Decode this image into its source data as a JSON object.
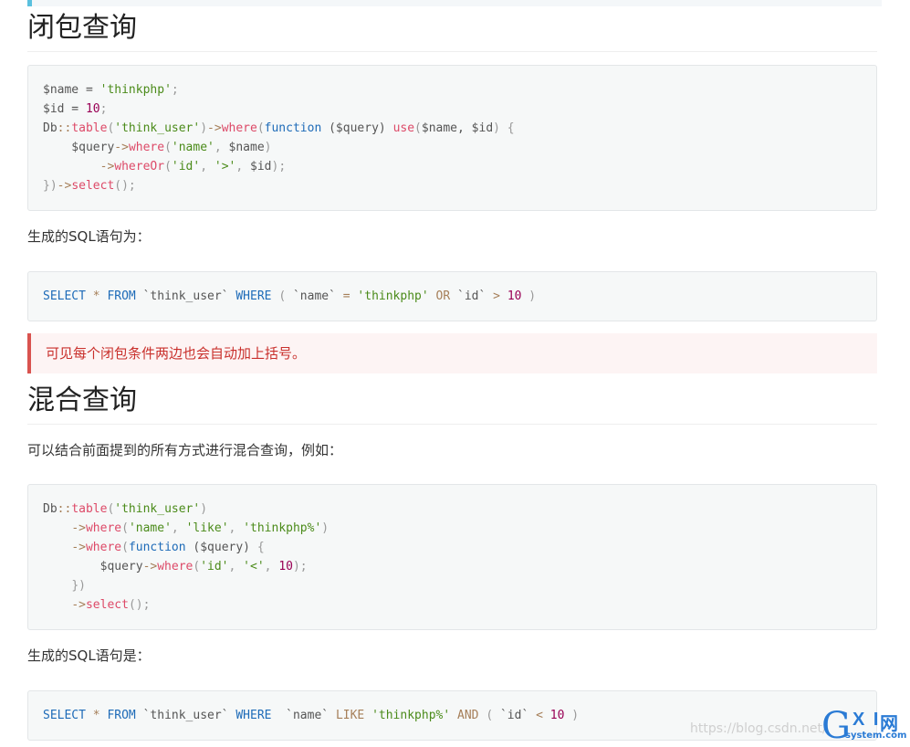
{
  "section1": {
    "title": "闭包查询",
    "code_lines": [
      [
        [
          "var",
          "$name = "
        ],
        [
          "str",
          "'thinkphp'"
        ],
        [
          "punc",
          ";"
        ]
      ],
      [
        [
          "var",
          "$id = "
        ],
        [
          "num",
          "10"
        ],
        [
          "punc",
          ";"
        ]
      ],
      [
        [
          "var",
          "Db"
        ],
        [
          "op",
          "::"
        ],
        [
          "fn",
          "table"
        ],
        [
          "punc",
          "("
        ],
        [
          "str",
          "'think_user'"
        ],
        [
          "punc",
          ")"
        ],
        [
          "op",
          "->"
        ],
        [
          "fn",
          "where"
        ],
        [
          "punc",
          "("
        ],
        [
          "kw",
          "function"
        ],
        [
          "var",
          " ($query) "
        ],
        [
          "fn",
          "use"
        ],
        [
          "punc",
          "("
        ],
        [
          "var",
          "$name, $id"
        ],
        [
          "punc",
          ") {"
        ]
      ],
      [
        [
          "var",
          "    $query"
        ],
        [
          "op",
          "->"
        ],
        [
          "fn",
          "where"
        ],
        [
          "punc",
          "("
        ],
        [
          "str",
          "'name'"
        ],
        [
          "punc",
          ", "
        ],
        [
          "var",
          "$name"
        ],
        [
          "punc",
          ")"
        ]
      ],
      [
        [
          "var",
          "        "
        ],
        [
          "op",
          "->"
        ],
        [
          "fn",
          "whereOr"
        ],
        [
          "punc",
          "("
        ],
        [
          "str",
          "'id'"
        ],
        [
          "punc",
          ", "
        ],
        [
          "str",
          "'>'"
        ],
        [
          "punc",
          ", "
        ],
        [
          "var",
          "$id"
        ],
        [
          "punc",
          ");"
        ]
      ],
      [
        [
          "punc",
          "})"
        ],
        [
          "op",
          "->"
        ],
        [
          "fn",
          "select"
        ],
        [
          "punc",
          "();"
        ]
      ]
    ],
    "sql_label": "生成的SQL语句为：",
    "sql_tokens": [
      [
        "kw",
        "SELECT"
      ],
      [
        "var",
        " "
      ],
      [
        "op",
        "*"
      ],
      [
        "var",
        " "
      ],
      [
        "kw",
        "FROM"
      ],
      [
        "var",
        " `think_user` "
      ],
      [
        "kw",
        "WHERE"
      ],
      [
        "var",
        " "
      ],
      [
        "punc",
        "("
      ],
      [
        "var",
        " `name` "
      ],
      [
        "op",
        "="
      ],
      [
        "var",
        " "
      ],
      [
        "str",
        "'thinkphp'"
      ],
      [
        "var",
        " "
      ],
      [
        "op",
        "OR"
      ],
      [
        "var",
        " `id` "
      ],
      [
        "op",
        ">"
      ],
      [
        "var",
        " "
      ],
      [
        "num",
        "10"
      ],
      [
        "var",
        " "
      ],
      [
        "punc",
        ")"
      ]
    ]
  },
  "warning": "可见每个闭包条件两边也会自动加上括号。",
  "section2": {
    "title": "混合查询",
    "intro": "可以结合前面提到的所有方式进行混合查询，例如：",
    "code_lines": [
      [
        [
          "var",
          "Db"
        ],
        [
          "op",
          "::"
        ],
        [
          "fn",
          "table"
        ],
        [
          "punc",
          "("
        ],
        [
          "str",
          "'think_user'"
        ],
        [
          "punc",
          ")"
        ]
      ],
      [
        [
          "var",
          "    "
        ],
        [
          "op",
          "->"
        ],
        [
          "fn",
          "where"
        ],
        [
          "punc",
          "("
        ],
        [
          "str",
          "'name'"
        ],
        [
          "punc",
          ", "
        ],
        [
          "str",
          "'like'"
        ],
        [
          "punc",
          ", "
        ],
        [
          "str",
          "'thinkphp%'"
        ],
        [
          "punc",
          ")"
        ]
      ],
      [
        [
          "var",
          "    "
        ],
        [
          "op",
          "->"
        ],
        [
          "fn",
          "where"
        ],
        [
          "punc",
          "("
        ],
        [
          "kw",
          "function"
        ],
        [
          "var",
          " ($query) "
        ],
        [
          "punc",
          "{"
        ]
      ],
      [
        [
          "var",
          "        $query"
        ],
        [
          "op",
          "->"
        ],
        [
          "fn",
          "where"
        ],
        [
          "punc",
          "("
        ],
        [
          "str",
          "'id'"
        ],
        [
          "punc",
          ", "
        ],
        [
          "str",
          "'<'"
        ],
        [
          "punc",
          ", "
        ],
        [
          "num",
          "10"
        ],
        [
          "punc",
          ");"
        ]
      ],
      [
        [
          "var",
          "    "
        ],
        [
          "punc",
          "})"
        ]
      ],
      [
        [
          "var",
          "    "
        ],
        [
          "op",
          "->"
        ],
        [
          "fn",
          "select"
        ],
        [
          "punc",
          "();"
        ]
      ]
    ],
    "sql_label": "生成的SQL语句是：",
    "sql_tokens": [
      [
        "kw",
        "SELECT"
      ],
      [
        "var",
        " "
      ],
      [
        "op",
        "*"
      ],
      [
        "var",
        " "
      ],
      [
        "kw",
        "FROM"
      ],
      [
        "var",
        " `think_user` "
      ],
      [
        "kw",
        "WHERE"
      ],
      [
        "var",
        "  `name` "
      ],
      [
        "op",
        "LIKE"
      ],
      [
        "var",
        " "
      ],
      [
        "str",
        "'thinkphp%'"
      ],
      [
        "var",
        " "
      ],
      [
        "op",
        "AND"
      ],
      [
        "var",
        " "
      ],
      [
        "punc",
        "("
      ],
      [
        "var",
        " `id` "
      ],
      [
        "op",
        "<"
      ],
      [
        "var",
        " "
      ],
      [
        "num",
        "10"
      ],
      [
        "var",
        " "
      ],
      [
        "punc",
        ")"
      ]
    ]
  },
  "watermark": {
    "url": "https://blog.csdn.net/",
    "logo_g": "G",
    "logo_xi": "X I",
    "logo_wang": "网",
    "logo_sub": "system.com"
  }
}
